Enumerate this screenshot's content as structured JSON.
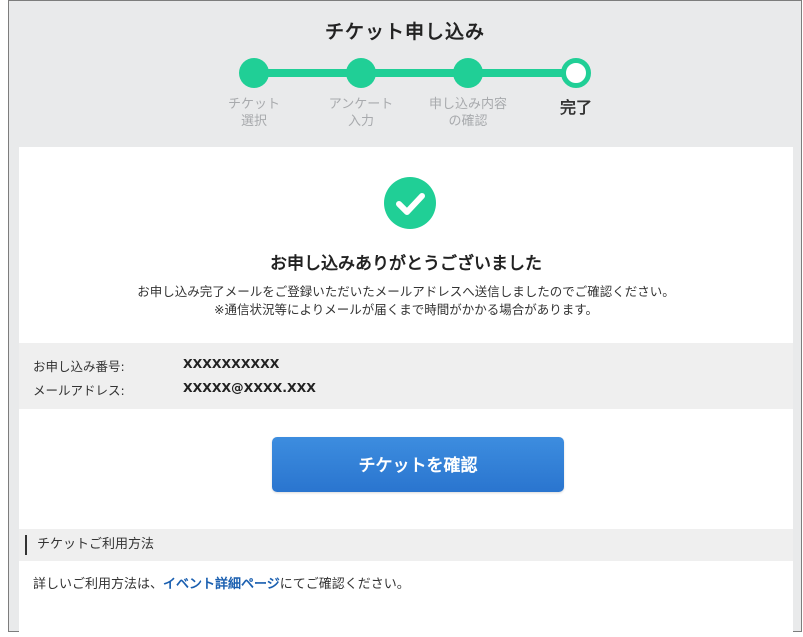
{
  "header": {
    "title": "チケット申し込み"
  },
  "steps": [
    {
      "label": "チケット\n選択",
      "state": "done"
    },
    {
      "label": "アンケート\n入力",
      "state": "done"
    },
    {
      "label": "申し込み内容\nの確認",
      "state": "done"
    },
    {
      "label": "完了",
      "state": "current"
    }
  ],
  "completion": {
    "icon": "check-circle-icon",
    "title": "お申し込みありがとうございました",
    "message_line1": "お申し込み完了メールをご登録いただいたメールアドレスへ送信しましたのでご確認ください。",
    "message_line2": "※通信状況等によりメールが届くまで時間がかかる場合があります。"
  },
  "order_info": {
    "number_label": "お申し込み番号:",
    "number_value": "XXXXXXXXXX",
    "email_label": "メールアドレス:",
    "email_value": "XXXXX@XXXX.XXX"
  },
  "confirm_button": {
    "label": "チケットを確認"
  },
  "usage": {
    "section_title": "チケットご利用方法",
    "text_before": "詳しいご利用方法は、",
    "link_text": "イベント詳細ページ",
    "text_after": "にてご確認ください。"
  },
  "colors": {
    "accent_green": "#20cf96",
    "button_blue": "#2f7fd6",
    "link_blue": "#1a5fb0"
  }
}
